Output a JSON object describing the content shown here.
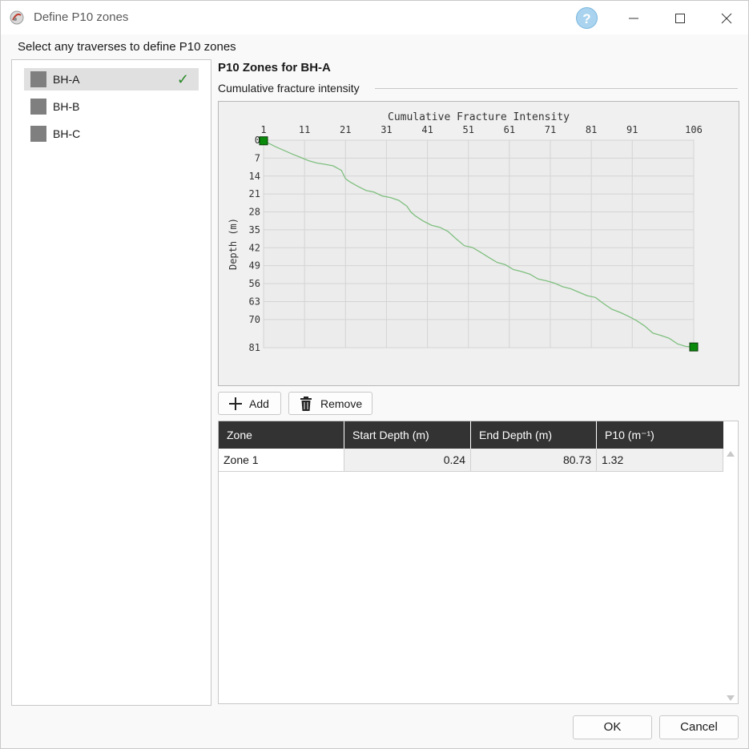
{
  "window": {
    "title": "Define P10 zones",
    "help_label": "?"
  },
  "instruction": "Select any traverses to define P10 zones",
  "traverses": [
    {
      "label": "BH-A",
      "selected": true,
      "check": "✓"
    },
    {
      "label": "BH-B",
      "selected": false
    },
    {
      "label": "BH-C",
      "selected": false
    }
  ],
  "section_title": "P10 Zones for BH-A",
  "subheading": "Cumulative fracture intensity",
  "chart_data": {
    "type": "line",
    "title": "Cumulative Fracture Intensity",
    "xlabel": "",
    "ylabel": "Depth (m)",
    "x_ticks": [
      "1",
      "11",
      "21",
      "31",
      "41",
      "51",
      "61",
      "71",
      "81",
      "91",
      "106"
    ],
    "y_ticks": [
      "0",
      "7",
      "14",
      "21",
      "28",
      "35",
      "42",
      "49",
      "56",
      "63",
      "70",
      "81"
    ],
    "xlim": [
      1,
      106
    ],
    "ylim": [
      0,
      81
    ],
    "grid": true,
    "line_color": "#7fbf7f",
    "marker_color": "#0a8a0a",
    "series": [
      {
        "x": [
          1,
          2,
          4,
          6,
          8,
          10,
          12,
          14,
          16,
          18,
          20,
          21,
          22,
          24,
          26,
          28,
          30,
          32,
          34,
          36,
          37,
          38,
          40,
          42,
          44,
          46,
          48,
          50,
          52,
          54,
          56,
          58,
          60,
          62,
          64,
          66,
          68,
          70,
          72,
          74,
          76,
          78,
          80,
          82,
          84,
          86,
          88,
          90,
          92,
          94,
          96,
          98,
          100,
          102,
          104,
          106
        ],
        "y": [
          0.24,
          1.0,
          2.6,
          4.0,
          5.4,
          6.7,
          8.0,
          8.9,
          9.4,
          10.0,
          11.8,
          15.0,
          16.2,
          18.0,
          19.6,
          20.3,
          21.8,
          22.4,
          23.5,
          25.8,
          28.1,
          29.5,
          31.6,
          33.2,
          34.0,
          35.6,
          38.5,
          41.2,
          41.9,
          43.8,
          45.8,
          47.7,
          48.6,
          50.5,
          51.3,
          52.3,
          54.2,
          54.9,
          55.8,
          57.2,
          58.0,
          59.4,
          60.7,
          61.4,
          63.8,
          66.0,
          67.2,
          68.7,
          70.4,
          72.5,
          75.3,
          76.2,
          77.3,
          79.5,
          80.5,
          80.73
        ]
      }
    ]
  },
  "toolbar": {
    "add_label": "Add",
    "remove_label": "Remove"
  },
  "table": {
    "columns": [
      "Zone",
      "Start Depth (m)",
      "End Depth (m)",
      "P10 (m⁻¹)"
    ],
    "rows": [
      {
        "zone": "Zone 1",
        "start": "0.24",
        "end": "80.73",
        "p10": "1.32"
      }
    ]
  },
  "buttons": {
    "ok": "OK",
    "cancel": "Cancel"
  }
}
